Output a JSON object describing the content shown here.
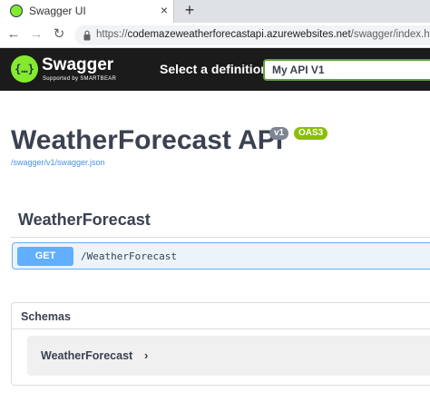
{
  "browser": {
    "tab_title": "Swagger UI",
    "tab_close": "×",
    "new_tab": "+",
    "back": "←",
    "forward": "→",
    "reload": "↻",
    "url_prefix": "https://",
    "url_main": "codemazeweatherforecastapi.azurewebsites.net",
    "url_path": "/swagger/index.html"
  },
  "topbar": {
    "logo_icon_text": "{…}",
    "logo_title": "Swagger",
    "logo_subtitle": "Supported by SMARTBEAR",
    "select_label": "Select a definition",
    "selected_definition": "My API V1",
    "accent_color": "#85ea2d"
  },
  "info": {
    "title": "WeatherForecast API",
    "version_badge": "v1",
    "oas_badge": "OAS3",
    "spec_link": "/swagger/v1/swagger.json"
  },
  "operations": {
    "tag": "WeatherForecast",
    "items": [
      {
        "method": "GET",
        "path": "/WeatherForecast",
        "color": "#61affe"
      }
    ]
  },
  "schemas": {
    "title": "Schemas",
    "models": [
      {
        "name": "WeatherForecast",
        "chevron": "›"
      }
    ]
  }
}
